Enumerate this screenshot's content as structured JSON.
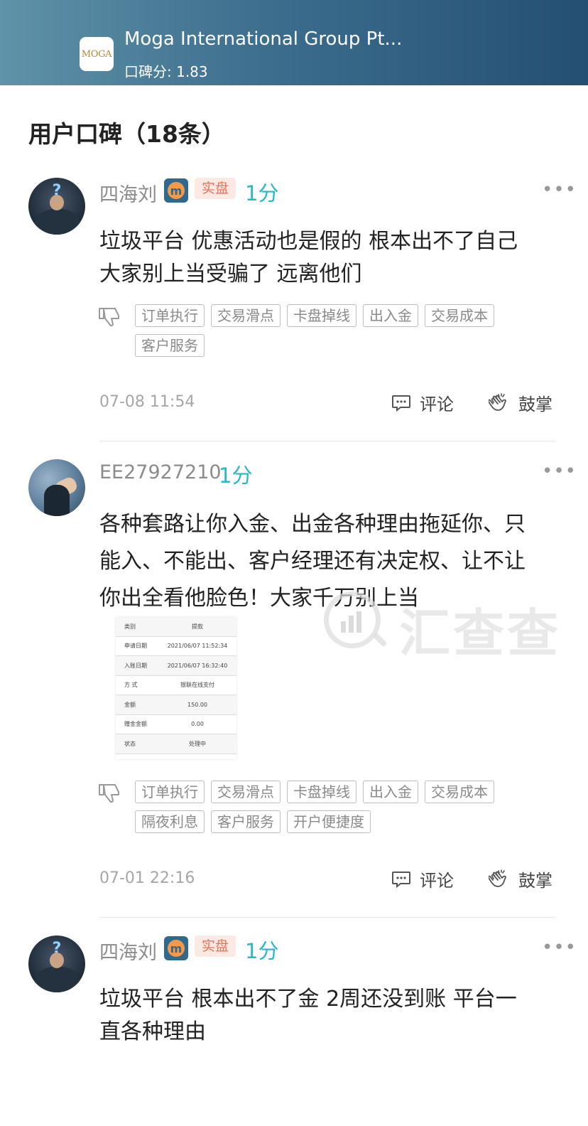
{
  "header": {
    "broker_name": "Moga International Group Pt...",
    "score_label": "口碑分: 1.83",
    "logo_text": "MOGA"
  },
  "section": {
    "title": "用户口碑（18条）"
  },
  "reviews": [
    {
      "user": "四海刘",
      "account_badge": "实盘",
      "score": "1分",
      "more": "•••",
      "text_lines": [
        "垃圾平台  优惠活动也是假的  根本出不了自己",
        "大家别上当受骗了 远离他们"
      ],
      "tags": [
        "订单执行",
        "交易滑点",
        "卡盘掉线",
        "出入金",
        "交易成本",
        "客户服务"
      ],
      "time": "07-08 11:54",
      "comment_label": "评论",
      "clap_label": "鼓掌"
    },
    {
      "user": "EE27927210",
      "score": "1分",
      "more": "•••",
      "text_lines": [
        "各种套路让你入金、出金各种理由拖延你、只",
        "能入、不能出、客户经理还有决定权、让不让",
        "你出全看他脸色！大家千万别上当"
      ],
      "attachment_rows": [
        {
          "k": "类别",
          "v": "提款"
        },
        {
          "k": "申请日期",
          "v": "2021/06/07 11:52:34"
        },
        {
          "k": "入账日期",
          "v": "2021/06/07 16:32:40"
        },
        {
          "k": "方 式",
          "v": "银联在线支付"
        },
        {
          "k": "金额",
          "v": "150.00"
        },
        {
          "k": "赠金金额",
          "v": "0.00"
        },
        {
          "k": "状态",
          "v": "处理中"
        }
      ],
      "tags": [
        "订单执行",
        "交易滑点",
        "卡盘掉线",
        "出入金",
        "交易成本",
        "隔夜利息",
        "客户服务",
        "开户便捷度"
      ],
      "time": "07-01 22:16",
      "comment_label": "评论",
      "clap_label": "鼓掌"
    },
    {
      "user": "四海刘",
      "account_badge": "实盘",
      "score": "1分",
      "more": "•••",
      "text_lines": [
        "垃圾平台  根本出不了金  2周还没到账  平台一",
        "直各种理由"
      ]
    }
  ],
  "watermark": {
    "text": "汇查查"
  },
  "colors": {
    "accent": "#27b7c6",
    "badge_text": "#f06f52",
    "badge_bg": "#fde9e4",
    "header_start": "#5f93a8",
    "header_end": "#244f73"
  }
}
